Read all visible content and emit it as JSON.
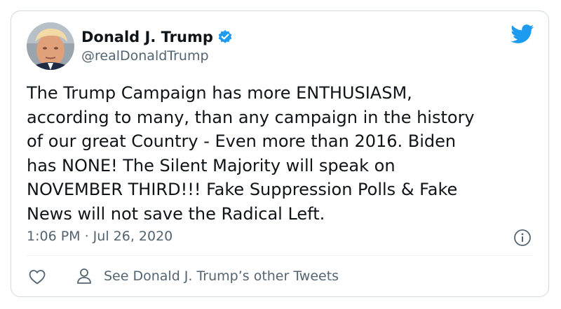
{
  "author": {
    "name": "Donald J. Trump",
    "handle": "@realDonaldTrump",
    "verified": true
  },
  "tweet": {
    "lines": [
      "The Trump Campaign has more ENTHUSIASM,",
      "according to many, than any campaign in the history",
      "of our great Country - Even more than 2016. Biden",
      "has NONE! The Silent Majority will speak on",
      "NOVEMBER THIRD!!! Fake Suppression Polls & Fake",
      "News will not save the Radical Left."
    ],
    "timestamp": "1:06 PM · Jul 26, 2020"
  },
  "actions": {
    "other_tweets_label": "See Donald J. Trump’s other Tweets"
  },
  "icons": {
    "twitter": "twitter-bird-icon",
    "verified": "verified-badge-icon",
    "info": "info-icon",
    "like": "heart-icon",
    "person": "person-icon"
  },
  "colors": {
    "brand_blue": "#1d9bf0",
    "text_primary": "#0f1419",
    "text_secondary": "#536471",
    "border": "#cfd9de"
  }
}
